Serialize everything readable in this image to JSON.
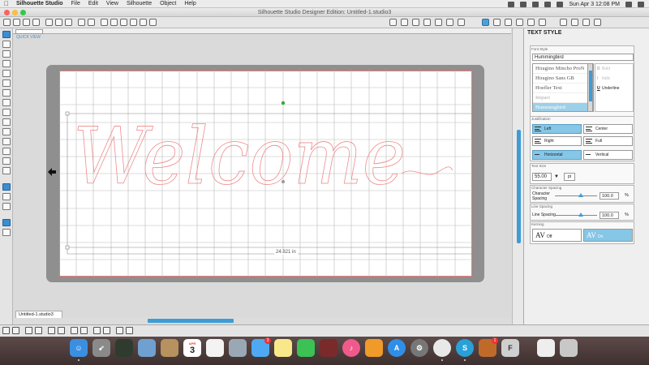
{
  "menubar": {
    "app_name": "Silhouette Studio",
    "menus": [
      "File",
      "Edit",
      "View",
      "Silhouette",
      "Object",
      "Help"
    ],
    "clock": "Sun Apr 3  12:08 PM"
  },
  "window": {
    "title": "Silhouette Studio Designer Edition: Untitled-1.studio3"
  },
  "canvas": {
    "quick_view": "QUICK VIEW",
    "artwork_text": "Welcome",
    "width_label": "24.821 in"
  },
  "doc_tab": {
    "label": "Untitled-1.studio3"
  },
  "panel": {
    "title": "TEXT STYLE",
    "font_style_label": "Font Style",
    "font_search_value": "Hummingbird",
    "fonts": [
      "Hiragino Mincho ProN",
      "Hiragino Sans GB",
      "Hoefler Text",
      "Impact",
      "Hummingbird"
    ],
    "styles": {
      "bold": "Bold",
      "italic": "Italic",
      "underline": "Underline"
    },
    "justification_label": "Justification",
    "justification": {
      "left": "Left",
      "center": "Center",
      "right": "Right",
      "full": "Full"
    },
    "direction": {
      "horizontal": "Horizontal",
      "vertical": "Vertical"
    },
    "size_label": "Text Size",
    "size_value": "55.00",
    "size_unit": "pt",
    "char_spacing_section": "Character Spacing",
    "char_spacing_label": "Character Spacing",
    "char_spacing_value": "100.0",
    "line_spacing_section": "Line Spacing",
    "line_spacing_label": "Line Spacing",
    "line_spacing_value": "100.0",
    "percent": "%",
    "kerning_label": "Kerning",
    "kerning_off": "Off",
    "kerning_on": "On"
  },
  "dock": {
    "calendar_day": "3",
    "calendar_month": "APR",
    "messages_badge": "3",
    "extra_badge": "1"
  },
  "colors": {
    "accent": "#3f9bd6",
    "selected": "#86c6e6",
    "mat": "#8f8f8f",
    "cut_border": "#ee7777"
  }
}
